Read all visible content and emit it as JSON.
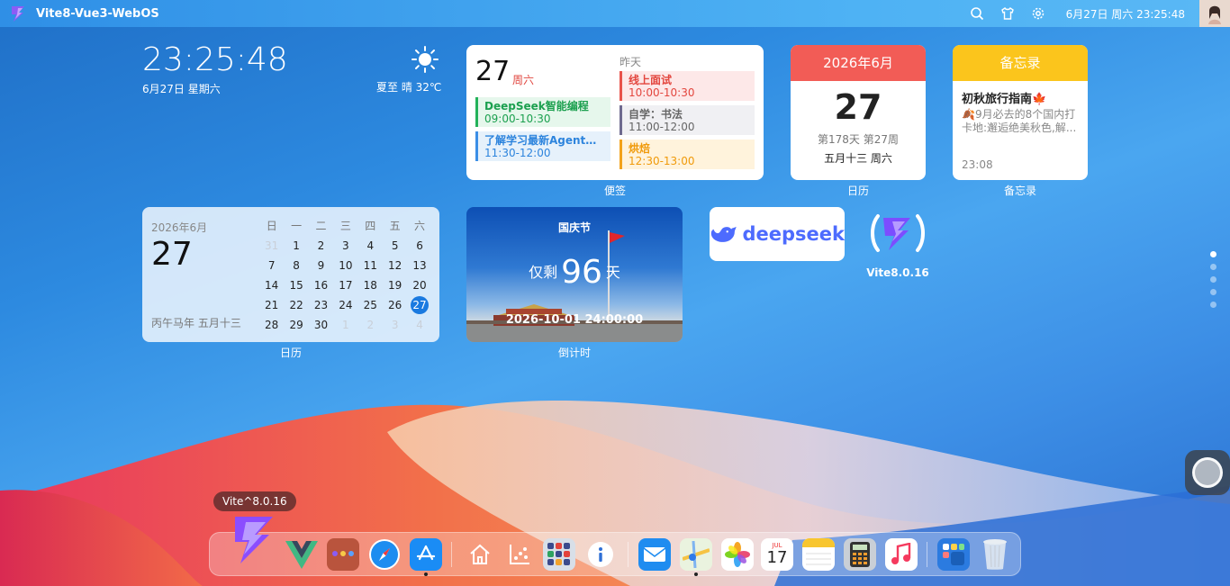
{
  "topbar": {
    "title": "Vite8-Vue3-WebOS",
    "datetime": "6月27日 周六 23:25:48",
    "icons": [
      "search-icon",
      "shirt-icon",
      "gear-icon"
    ]
  },
  "clock_widget": {
    "time": "23:25:48",
    "date": "6月27日 星期六",
    "weather": "夏至 晴 32℃"
  },
  "memo_widget": {
    "day": "27",
    "weekday": "周六",
    "yesterday_label": "昨天",
    "left_events": [
      {
        "name": "DeepSeek智能编程",
        "time": "09:00-10:30"
      },
      {
        "name": "了解学习最新Agent模...",
        "time": "11:30-12:00"
      }
    ],
    "right_events": [
      {
        "name": "线上面试",
        "time": "10:00-10:30"
      },
      {
        "name": "自学：书法",
        "time": "11:00-12:00"
      },
      {
        "name": "烘焙",
        "time": "12:30-13:00"
      }
    ],
    "caption": "便签"
  },
  "calendar_card": {
    "header": "2026年6月",
    "day": "27",
    "line1": "第178天 第27周",
    "line2": "五月十三 周六",
    "caption": "日历"
  },
  "notes_card": {
    "header": "备忘录",
    "title": "初秋旅行指南🍁",
    "body": "🍂9月必去的8个国内打卡地:邂逅绝美秋色,解...",
    "time": "23:08",
    "caption": "备忘录"
  },
  "month_calendar": {
    "year_month": "2026年6月",
    "day": "27",
    "lunar": "丙午马年 五月十三",
    "weekdays": [
      "日",
      "一",
      "二",
      "三",
      "四",
      "五",
      "六"
    ],
    "weeks": [
      [
        "31",
        "1",
        "2",
        "3",
        "4",
        "5",
        "6"
      ],
      [
        "7",
        "8",
        "9",
        "10",
        "11",
        "12",
        "13"
      ],
      [
        "14",
        "15",
        "16",
        "17",
        "18",
        "19",
        "20"
      ],
      [
        "21",
        "22",
        "23",
        "24",
        "25",
        "26",
        "27"
      ],
      [
        "28",
        "29",
        "30",
        "1",
        "2",
        "3",
        "4"
      ]
    ],
    "today": "27",
    "caption": "日历"
  },
  "countdown": {
    "holiday": "国庆节",
    "prefix": "仅剩",
    "days": "96",
    "suffix": "天",
    "target": "2026-10-01 24:00:00",
    "caption": "倒计时"
  },
  "deepseek": {
    "label": "deepseek"
  },
  "vite_app": {
    "label": "Vite8.0.16"
  },
  "dock": {
    "tooltip": "Vite^8.0.16",
    "apps": [
      "vite-icon",
      "vue-icon",
      "folder-icon",
      "safari-icon",
      "appstore-icon",
      "home-icon",
      "chart-icon",
      "apps-grid-icon",
      "info-icon",
      "mail-icon",
      "maps-icon",
      "photos-icon",
      "calendar-icon",
      "notes-icon",
      "calculator-icon",
      "music-icon",
      "launchpad-icon",
      "trash-icon"
    ],
    "calendar_icon_month": "JUL",
    "calendar_icon_day": "17"
  }
}
